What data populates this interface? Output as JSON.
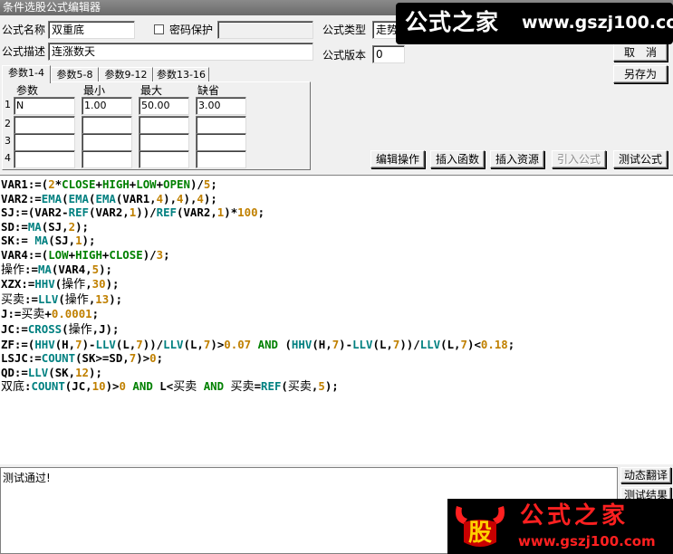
{
  "window": {
    "title": "条件选股公式编辑器"
  },
  "form": {
    "name_label": "公式名称",
    "name_value": "双重底",
    "password_label": "密码保护",
    "password_value": "",
    "desc_label": "公式描述",
    "desc_value": "连涨数天",
    "type_label": "公式类型",
    "type_value": "走势特",
    "version_label": "公式版本",
    "version_value": "0"
  },
  "buttons": {
    "cancel": "取　消",
    "save_as": "另存为",
    "edit_op": "编辑操作",
    "insert_func": "插入函数",
    "insert_res": "插入资源",
    "import_formula": "引入公式",
    "test_formula": "测试公式",
    "dynamic_translate": "动态翻译",
    "test_result": "测试结果"
  },
  "tabs": [
    "参数1-4",
    "参数5-8",
    "参数9-12",
    "参数13-16"
  ],
  "params": {
    "headers": [
      "参数",
      "最小",
      "最大",
      "缺省"
    ],
    "rows": [
      {
        "num": "1",
        "name": "N",
        "min": "1.00",
        "max": "50.00",
        "default": "3.00"
      },
      {
        "num": "2",
        "name": "",
        "min": "",
        "max": "",
        "default": ""
      },
      {
        "num": "3",
        "name": "",
        "min": "",
        "max": "",
        "default": ""
      },
      {
        "num": "4",
        "name": "",
        "min": "",
        "max": "",
        "default": ""
      }
    ]
  },
  "code_lines": [
    "VAR1:=(2*CLOSE+HIGH+LOW+OPEN)/5;",
    "VAR2:=EMA(EMA(EMA(VAR1,4),4),4);",
    "SJ:=(VAR2-REF(VAR2,1))/REF(VAR2,1)*100;",
    "SD:=MA(SJ,2);",
    "SK:= MA(SJ,1);",
    "VAR4:=(LOW+HIGH+CLOSE)/3;",
    "操作:=MA(VAR4,5);",
    "XZX:=HHV(操作,30);",
    "买卖:=LLV(操作,13);",
    "J:=买卖+0.0001;",
    "JC:=CROSS(操作,J);",
    "ZF:=(HHV(H,7)-LLV(L,7))/LLV(L,7)>0.07 AND (HHV(H,7)-LLV(L,7))/LLV(L,7)<0.18;",
    "LSJC:=COUNT(SK>=SD,7)>0;",
    "QD:=LLV(SK,12);",
    "双底:COUNT(JC,10)>0 AND L<买卖 AND 买卖=REF(买卖,5);"
  ],
  "status": {
    "message": "测试通过!"
  },
  "watermark_top": {
    "text": "公式之家",
    "url": "www.gszj100.com"
  },
  "watermark_bottom": {
    "logo": "股",
    "text": "公式之家",
    "url": "www.gszj100.com"
  }
}
